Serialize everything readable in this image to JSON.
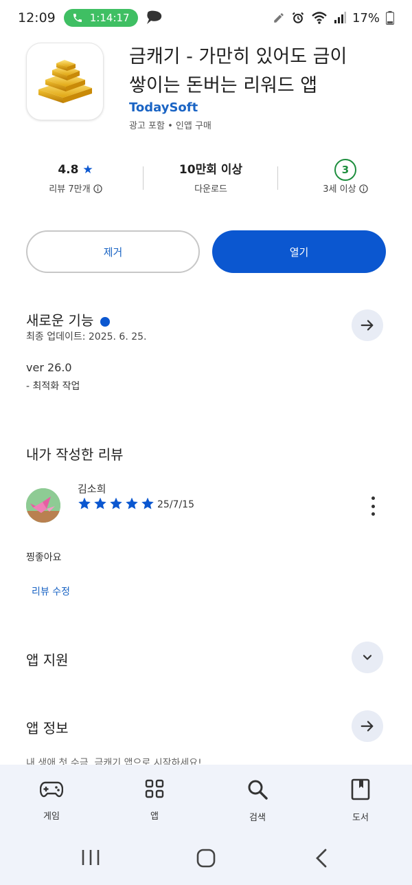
{
  "status_bar": {
    "time": "12:09",
    "call_duration": "1:14:17",
    "battery": "17%"
  },
  "app": {
    "title_line1": "금캐기 - 가만히 있어도 금이",
    "title_line2": "쌓이는 돈버는 리워드 앱",
    "developer": "TodaySoft",
    "ads_label": "광고 포함 • 인앱 구매"
  },
  "stats": {
    "rating": "4.8",
    "rating_star": "★",
    "reviews": "리뷰 7만개",
    "downloads": "10만회 이상",
    "downloads_label": "다운로드",
    "age_rating": "3",
    "age_label": "3세 이상"
  },
  "actions": {
    "remove_label": "제거",
    "open_label": "열기"
  },
  "whats_new": {
    "title": "새로운 기능",
    "updated": "최종 업데이트: 2025. 6. 25.",
    "version": "ver 26.0",
    "note": "- 최적화 작업"
  },
  "my_review": {
    "section_title": "내가 작성한 리뷰",
    "reviewer": "김소희",
    "stars": 5,
    "date": "25/7/15",
    "text": "찡좋아요",
    "edit_label": "리뷰 수정"
  },
  "app_support": {
    "title": "앱 지원"
  },
  "app_info": {
    "title": "앱 정보",
    "preview": "내 생애 첫 수금, 금캐기 앱으로 시작하세요!"
  },
  "bottom_nav": {
    "items": [
      {
        "label": "게임",
        "icon": "gamepad-icon"
      },
      {
        "label": "앱",
        "icon": "apps-grid-icon"
      },
      {
        "label": "검색",
        "icon": "search-icon"
      },
      {
        "label": "도서",
        "icon": "book-icon"
      }
    ]
  },
  "colors": {
    "accent": "#0b57d0",
    "link": "#1a64c4",
    "age_green": "#1e8e3e",
    "call_green": "#3fbf63"
  }
}
